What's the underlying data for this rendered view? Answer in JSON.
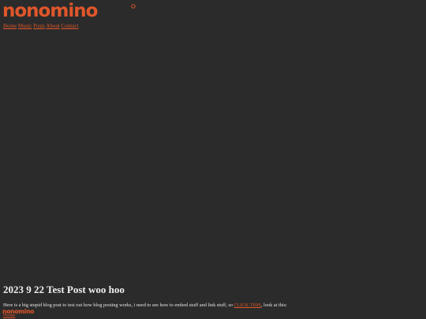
{
  "header": {
    "logo_text": "nonomino",
    "nav": [
      "Home",
      "Music",
      "Posts",
      "About",
      "Contact"
    ]
  },
  "post": {
    "title": "2023 9 22 Test Post woo hoo",
    "body_before": "Here is a big stupid blog post to test out how blog posting works, i need to see how to embed stuff and link stuff, so ",
    "link_text": "CLICK THIS",
    "body_after": ", look at this:"
  },
  "footer": {
    "logo_text": "nonomino",
    "link": "Home"
  },
  "colors": {
    "background": "#2b2b2b",
    "accent": "#e0572a",
    "text": "#e8e8e8"
  }
}
